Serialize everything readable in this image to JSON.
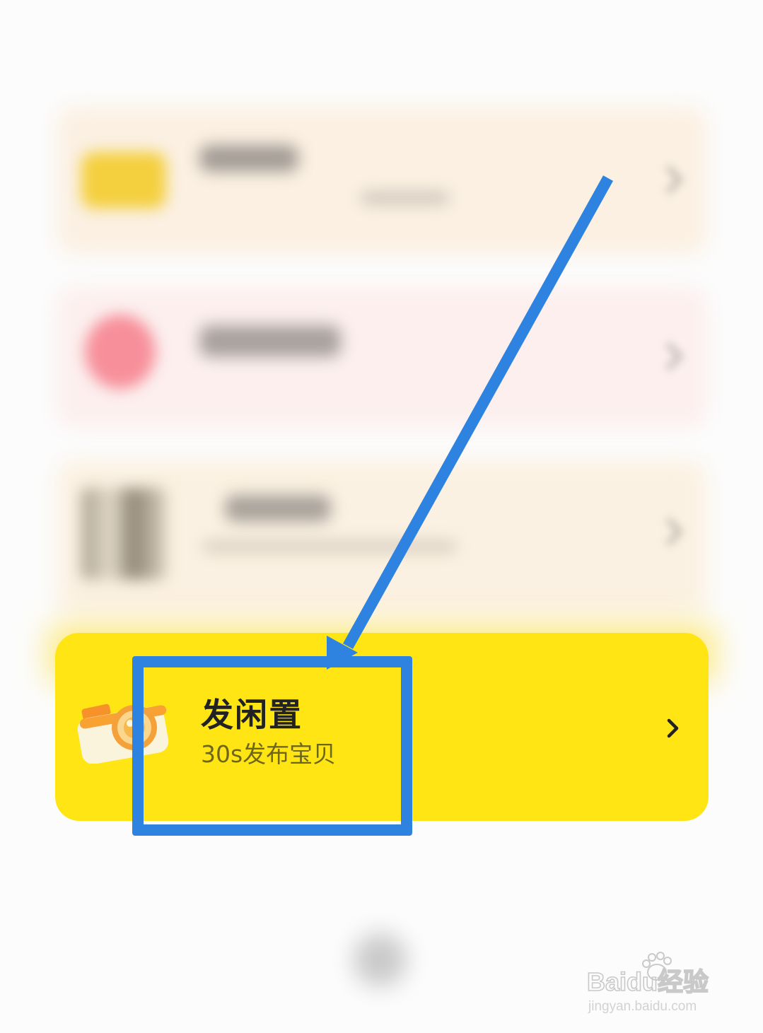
{
  "publish": {
    "title": "发闲置",
    "subtitle": "30s发布宝贝"
  },
  "watermark": {
    "brand": "Baidu经验",
    "url": "jingyan.baidu.com"
  },
  "colors": {
    "card_yellow": "#ffe513",
    "annotation_blue": "#2e83e0",
    "title_text": "#222222",
    "subtitle_text": "#6e661c"
  },
  "icons": {
    "publish": "camera-icon",
    "open": "chevron-right-icon"
  }
}
